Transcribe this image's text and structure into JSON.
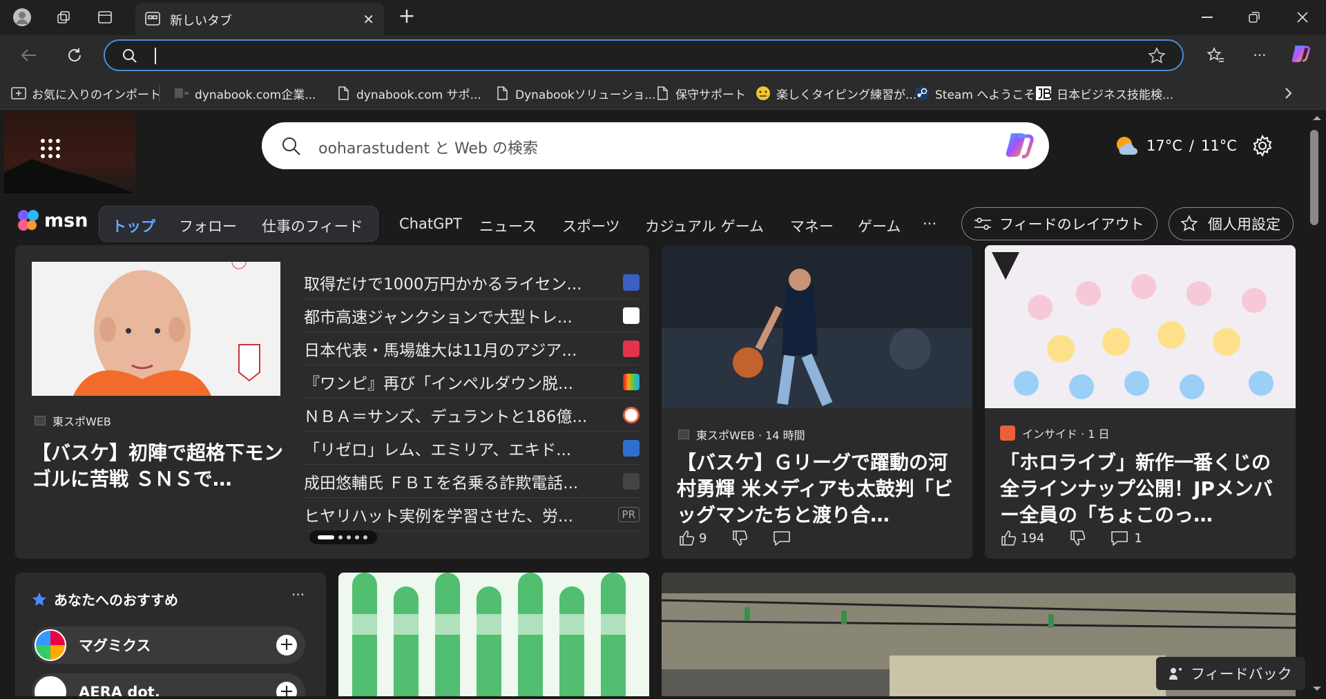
{
  "browser": {
    "tab_title": "新しいタブ",
    "new_tab": "+",
    "address_value": "",
    "bookmarks": [
      {
        "label": "お気に入りのインポート",
        "icon": "import-icon"
      },
      {
        "label": "dynabook.com企業...",
        "icon": "site-icon"
      },
      {
        "label": "dynabook.com サポ...",
        "icon": "page-icon"
      },
      {
        "label": "Dynabookソリューショ...",
        "icon": "page-icon"
      },
      {
        "label": "保守サポート",
        "icon": "page-icon"
      },
      {
        "label": "楽しくタイピング練習が...",
        "icon": "emoji-icon"
      },
      {
        "label": "Steam へようこそ",
        "icon": "steam-icon"
      },
      {
        "label": "日本ビジネス技能検...",
        "icon": "jb-icon"
      }
    ]
  },
  "msn": {
    "search_placeholder": "ooharastudent と Web の検索",
    "weather_high": "17°C",
    "weather_sep": "/",
    "weather_low": "11°C",
    "logo_text": "msn",
    "nav_pills": [
      "トップ",
      "フォロー",
      "仕事のフィード"
    ],
    "nav_items": [
      "ChatGPT",
      "ニュース",
      "スポーツ",
      "カジュアル ゲーム",
      "マネー",
      "ゲーム",
      "···"
    ],
    "feed_layout_btn": "フィードのレイアウト",
    "personalize_btn": "個人用設定"
  },
  "top_story": {
    "source": "東スポWEB",
    "headline": "【バスケ】初陣で超格下モンゴルに苦戦 ＳＮＳで…",
    "list": [
      {
        "text": "取得だけで1000万円かかるライセン...",
        "logo_color": "#3b5fc4"
      },
      {
        "text": "都市高速ジャンクションで大型トレ...",
        "logo_color": "#ffffff"
      },
      {
        "text": "日本代表・馬場雄大は11月のアジア...",
        "logo_color": "#e2334f"
      },
      {
        "text": "『ワンピ』再び「インペルダウン脱...",
        "logo_color": "#4aa3df"
      },
      {
        "text": "ＮＢＡ＝サンズ、デュラントと186億...",
        "logo_color": "#e8603c"
      },
      {
        "text": "「リゼロ」レム、エミリア、エキド...",
        "logo_color": "#2f6fd1"
      },
      {
        "text": "成田悠輔氏 ＦＢＩを名乗る詐欺電話...",
        "logo_color": "#444444"
      },
      {
        "text": "ヒヤリハット実例を学習させた、労...",
        "logo_color": "PR"
      }
    ]
  },
  "card_basket": {
    "source": "東スポWEB · 14 時間",
    "headline": "【バスケ】Ｇリーグで躍動の河村勇輝 米メディアも太鼓判「ビッグマンたちと渡り合…",
    "likes": "9"
  },
  "card_hololive": {
    "source": "インサイド · 1 日",
    "headline": "「ホロライブ」新作一番くじの全ラインナップ公開！JPメンバー全員の「ちょこのっ…",
    "likes": "194",
    "comments": "1"
  },
  "recommend": {
    "title": "あなたへのおすすめ",
    "more": "···",
    "publishers": [
      "マグミクス",
      "AERA dot."
    ]
  },
  "feedback_label": "フィードバック"
}
